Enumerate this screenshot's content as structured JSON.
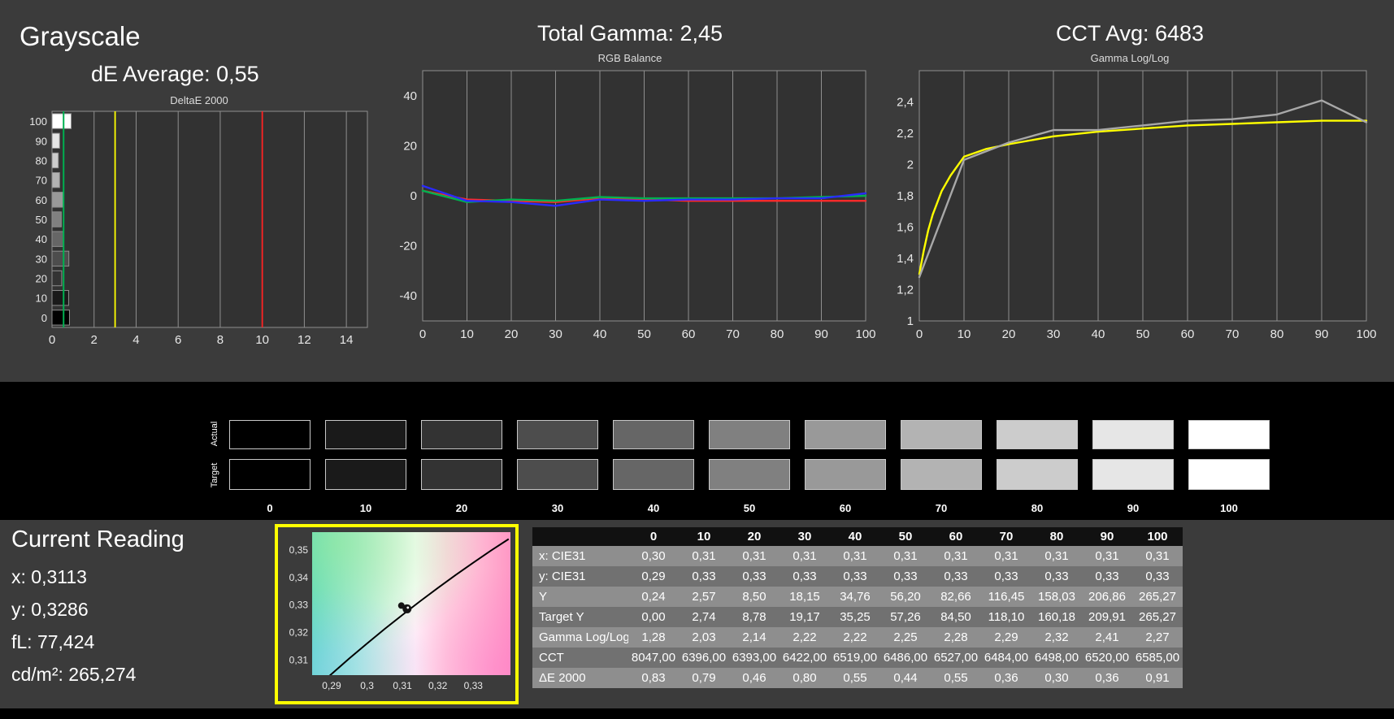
{
  "colors": {
    "background": "#3b3b3b",
    "plot_background": "#323232",
    "grid": "#8f8f8f",
    "strip_background": "#000000",
    "text": "#ffffff",
    "tick_text": "#e8e8e8",
    "accent_yellow": "#ffff00",
    "accent_red": "#ff2222",
    "accent_green": "#00b050",
    "accent_blue": "#2a2aff",
    "measured_gray": "#a8a8a8",
    "table_header_bg": "#111111",
    "table_row_light": "#8e8e8e",
    "table_row_dark": "#717171",
    "cie_border": "#ffff00"
  },
  "header": {
    "grayscale_title": "Grayscale",
    "de_average_label": "dE Average: 0,55",
    "total_gamma_label": "Total Gamma: 2,45",
    "cct_avg_label": "CCT Avg: 6483"
  },
  "chart_data": [
    {
      "type": "bar",
      "title": "DeltaE 2000",
      "orientation": "horizontal",
      "categories": [
        0,
        10,
        20,
        30,
        40,
        50,
        60,
        70,
        80,
        90,
        100
      ],
      "values": [
        0.83,
        0.79,
        0.46,
        0.8,
        0.55,
        0.44,
        0.55,
        0.36,
        0.3,
        0.36,
        0.91
      ],
      "bar_colors": [
        "#000000",
        "#1a1a1a",
        "#333333",
        "#4d4d4d",
        "#666666",
        "#808080",
        "#999999",
        "#b3b3b3",
        "#cccccc",
        "#e6e6e6",
        "#ffffff"
      ],
      "xlim": [
        0,
        15
      ],
      "xticks": [
        0,
        2,
        4,
        6,
        8,
        10,
        12,
        14
      ],
      "ref_lines": [
        {
          "name": "average",
          "value": 0.55,
          "color": "#00b050"
        },
        {
          "name": "warning",
          "value": 3,
          "color": "#ffff00"
        },
        {
          "name": "fail",
          "value": 10,
          "color": "#ff2222"
        }
      ]
    },
    {
      "type": "line",
      "title": "RGB Balance",
      "x": [
        0,
        10,
        20,
        30,
        40,
        50,
        60,
        70,
        80,
        90,
        100
      ],
      "xlim": [
        0,
        100
      ],
      "ylim": [
        -50,
        50
      ],
      "xticks": [
        0,
        10,
        20,
        30,
        40,
        50,
        60,
        70,
        80,
        90,
        100
      ],
      "yticks": [
        -40,
        -20,
        0,
        20,
        40
      ],
      "ytick_labels": [
        "-40",
        "-20",
        "0",
        "20",
        "40"
      ],
      "series": [
        {
          "name": "red",
          "color": "#ff2a2a",
          "values": [
            2,
            -1.5,
            -2,
            -2.5,
            -1,
            -1.5,
            -2,
            -2,
            -2,
            -2,
            -2
          ]
        },
        {
          "name": "green",
          "color": "#00b050",
          "values": [
            2,
            -2.5,
            -1.5,
            -2,
            -0.5,
            -1,
            -1,
            -1,
            -1,
            -0.5,
            0
          ]
        },
        {
          "name": "blue",
          "color": "#2a2aff",
          "values": [
            4,
            -2,
            -2.5,
            -4,
            -1.5,
            -2,
            -1.5,
            -1.5,
            -1,
            -1,
            1
          ]
        }
      ]
    },
    {
      "type": "line",
      "title": "Gamma Log/Log",
      "x": [
        0,
        10,
        20,
        30,
        40,
        50,
        60,
        70,
        80,
        90,
        100
      ],
      "xlim": [
        0,
        100
      ],
      "ylim": [
        1,
        2.6
      ],
      "xticks": [
        0,
        10,
        20,
        30,
        40,
        50,
        60,
        70,
        80,
        90,
        100
      ],
      "yticks": [
        1,
        1.2,
        1.4,
        1.6,
        1.8,
        2,
        2.2,
        2.4
      ],
      "ytick_labels": [
        "1",
        "1,2",
        "1,4",
        "1,6",
        "1,8",
        "2",
        "2,2",
        "2,4"
      ],
      "series": [
        {
          "name": "target",
          "color": "#ffff00",
          "x": [
            0,
            1,
            2,
            3,
            5,
            7,
            10,
            15,
            20,
            30,
            40,
            50,
            60,
            70,
            80,
            90,
            100
          ],
          "values": [
            1.3,
            1.45,
            1.58,
            1.68,
            1.83,
            1.93,
            2.05,
            2.1,
            2.13,
            2.18,
            2.21,
            2.23,
            2.25,
            2.26,
            2.27,
            2.28,
            2.28
          ]
        },
        {
          "name": "measured",
          "color": "#a8a8a8",
          "values": [
            1.28,
            2.03,
            2.14,
            2.22,
            2.22,
            2.25,
            2.28,
            2.29,
            2.32,
            2.41,
            2.27
          ]
        }
      ]
    },
    {
      "type": "scatter",
      "title": "CIE Chromaticity (zoom)",
      "xlim": [
        0.2845,
        0.3405
      ],
      "ylim": [
        0.3045,
        0.3565
      ],
      "xticks": [
        0.29,
        0.3,
        0.31,
        0.32,
        0.33
      ],
      "xtick_labels": [
        "0,29",
        "0,3",
        "0,31",
        "0,32",
        "0,33"
      ],
      "yticks": [
        0.31,
        0.32,
        0.33,
        0.34,
        0.35
      ],
      "ytick_labels": [
        "0,31",
        "0,32",
        "0,33",
        "0,34",
        "0,35"
      ],
      "locus": [
        [
          0.286,
          0.3004
        ],
        [
          0.295,
          0.3106
        ],
        [
          0.3,
          0.316
        ],
        [
          0.305,
          0.3213
        ],
        [
          0.31,
          0.3264
        ],
        [
          0.315,
          0.3314
        ],
        [
          0.32,
          0.3362
        ],
        [
          0.325,
          0.3409
        ],
        [
          0.33,
          0.3454
        ],
        [
          0.335,
          0.3498
        ],
        [
          0.34,
          0.354
        ]
      ],
      "point": {
        "x": 0.3113,
        "y": 0.3286
      }
    }
  ],
  "swatches": {
    "row_labels": [
      "Actual",
      "Target"
    ],
    "levels": [
      "0",
      "10",
      "20",
      "30",
      "40",
      "50",
      "60",
      "70",
      "80",
      "90",
      "100"
    ],
    "actual_colors": [
      "#000000",
      "#1a1a1a",
      "#333333",
      "#4d4d4d",
      "#666666",
      "#808080",
      "#999999",
      "#b3b3b3",
      "#cccccc",
      "#e6e6e6",
      "#ffffff"
    ],
    "target_colors": [
      "#000000",
      "#1a1a1a",
      "#333333",
      "#4d4d4d",
      "#666666",
      "#808080",
      "#999999",
      "#b3b3b3",
      "#cccccc",
      "#e6e6e6",
      "#ffffff"
    ]
  },
  "current_reading": {
    "title": "Current Reading",
    "x": "x: 0,3113",
    "y": "y: 0,3286",
    "fl": "fL: 77,424",
    "cdm2": "cd/m²: 265,274"
  },
  "table": {
    "columns": [
      "",
      "0",
      "10",
      "20",
      "30",
      "40",
      "50",
      "60",
      "70",
      "80",
      "90",
      "100"
    ],
    "rows": [
      {
        "label": "x: CIE31",
        "values": [
          "0,30",
          "0,31",
          "0,31",
          "0,31",
          "0,31",
          "0,31",
          "0,31",
          "0,31",
          "0,31",
          "0,31",
          "0,31"
        ]
      },
      {
        "label": "y: CIE31",
        "values": [
          "0,29",
          "0,33",
          "0,33",
          "0,33",
          "0,33",
          "0,33",
          "0,33",
          "0,33",
          "0,33",
          "0,33",
          "0,33"
        ]
      },
      {
        "label": "Y",
        "values": [
          "0,24",
          "2,57",
          "8,50",
          "18,15",
          "34,76",
          "56,20",
          "82,66",
          "116,45",
          "158,03",
          "206,86",
          "265,27"
        ]
      },
      {
        "label": "Target Y",
        "values": [
          "0,00",
          "2,74",
          "8,78",
          "19,17",
          "35,25",
          "57,26",
          "84,50",
          "118,10",
          "160,18",
          "209,91",
          "265,27"
        ]
      },
      {
        "label": "Gamma Log/Log",
        "values": [
          "1,28",
          "2,03",
          "2,14",
          "2,22",
          "2,22",
          "2,25",
          "2,28",
          "2,29",
          "2,32",
          "2,41",
          "2,27"
        ]
      },
      {
        "label": "CCT",
        "values": [
          "8047,00",
          "6396,00",
          "6393,00",
          "6422,00",
          "6519,00",
          "6486,00",
          "6527,00",
          "6484,00",
          "6498,00",
          "6520,00",
          "6585,00"
        ]
      },
      {
        "label": "ΔE 2000",
        "values": [
          "0,83",
          "0,79",
          "0,46",
          "0,80",
          "0,55",
          "0,44",
          "0,55",
          "0,36",
          "0,30",
          "0,36",
          "0,91"
        ]
      }
    ]
  }
}
